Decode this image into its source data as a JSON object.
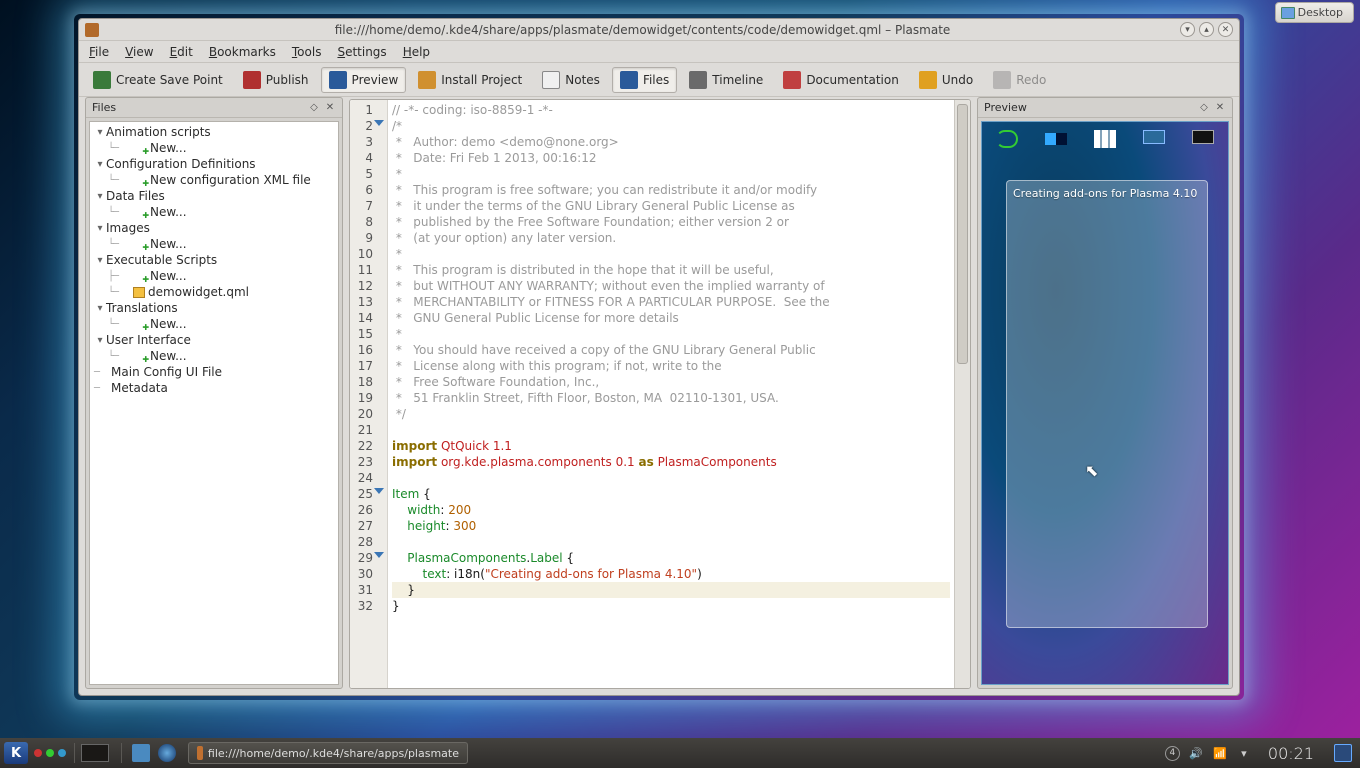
{
  "desktop_button": "Desktop",
  "window": {
    "title": "file:///home/demo/.kde4/share/apps/plasmate/demowidget/contents/code/demowidget.qml – Plasmate",
    "min_tip": "Minimize",
    "max_tip": "Maximize",
    "close_tip": "Close"
  },
  "menus": [
    "File",
    "View",
    "Edit",
    "Bookmarks",
    "Tools",
    "Settings",
    "Help"
  ],
  "toolbar": {
    "save_point": "Create Save Point",
    "publish": "Publish",
    "preview": "Preview",
    "install": "Install Project",
    "notes": "Notes",
    "files": "Files",
    "timeline": "Timeline",
    "documentation": "Documentation",
    "undo": "Undo",
    "redo": "Redo"
  },
  "files_panel": {
    "title": "Files",
    "tree": {
      "animation_scripts": "Animation scripts",
      "new": "New...",
      "config_defs": "Configuration Definitions",
      "new_config_xml": "New configuration XML file",
      "data_files": "Data Files",
      "images": "Images",
      "exec_scripts": "Executable Scripts",
      "demowidget": "demowidget.qml",
      "translations": "Translations",
      "ui": "User Interface",
      "main_config": "Main Config UI File",
      "metadata": "Metadata"
    }
  },
  "preview_panel": {
    "title": "Preview",
    "card_text": "Creating add-ons for Plasma 4.10"
  },
  "code_lines": [
    {
      "t": "// -*- coding: iso-8859-1 -*-",
      "c": "cm"
    },
    {
      "t": "/*",
      "c": "cm",
      "fold": true
    },
    {
      "t": " *   Author: demo <demo@none.org>",
      "c": "cm"
    },
    {
      "t": " *   Date: Fri Feb 1 2013, 00:16:12",
      "c": "cm"
    },
    {
      "t": " *",
      "c": "cm"
    },
    {
      "t": " *   This program is free software; you can redistribute it and/or modify",
      "c": "cm"
    },
    {
      "t": " *   it under the terms of the GNU Library General Public License as",
      "c": "cm"
    },
    {
      "t": " *   published by the Free Software Foundation; either version 2 or",
      "c": "cm"
    },
    {
      "t": " *   (at your option) any later version.",
      "c": "cm"
    },
    {
      "t": " *",
      "c": "cm"
    },
    {
      "t": " *   This program is distributed in the hope that it will be useful,",
      "c": "cm"
    },
    {
      "t": " *   but WITHOUT ANY WARRANTY; without even the implied warranty of",
      "c": "cm"
    },
    {
      "t": " *   MERCHANTABILITY or FITNESS FOR A PARTICULAR PURPOSE.  See the",
      "c": "cm"
    },
    {
      "t": " *   GNU General Public License for more details",
      "c": "cm"
    },
    {
      "t": " *",
      "c": "cm"
    },
    {
      "t": " *   You should have received a copy of the GNU Library General Public",
      "c": "cm"
    },
    {
      "t": " *   License along with this program; if not, write to the",
      "c": "cm"
    },
    {
      "t": " *   Free Software Foundation, Inc.,",
      "c": "cm"
    },
    {
      "t": " *   51 Franklin Street, Fifth Floor, Boston, MA  02110-1301, USA.",
      "c": "cm"
    },
    {
      "t": " */",
      "c": "cm"
    },
    {
      "t": "",
      "c": ""
    },
    {
      "html": "<span class='kw'>import</span> <span class='im'>QtQuick 1.1</span>"
    },
    {
      "html": "<span class='kw'>import</span> <span class='im'>org.kde.plasma.components 0.1</span> <span class='kw'>as</span> <span class='im'>PlasmaComponents</span>"
    },
    {
      "t": "",
      "c": ""
    },
    {
      "html": "<span class='ty'>Item</span> {",
      "fold": true
    },
    {
      "html": "    <span class='pr'>width</span>: <span class='nu'>200</span>"
    },
    {
      "html": "    <span class='pr'>height</span>: <span class='nu'>300</span>"
    },
    {
      "t": "",
      "c": ""
    },
    {
      "html": "    <span class='ty'>PlasmaComponents</span>.<span class='ty'>Label</span> {",
      "fold": true
    },
    {
      "html": "        <span class='pr'>text</span>: i18n(<span class='st'>\"Creating add-ons for Plasma 4.10\"</span>)"
    },
    {
      "html": "<span class='hl'>    }</span>"
    },
    {
      "t": "}",
      "c": ""
    }
  ],
  "taskbar": {
    "task_title": "file:///home/demo/.kde4/share/apps/plasmate",
    "tray_num": "4",
    "clock": "00:21"
  }
}
